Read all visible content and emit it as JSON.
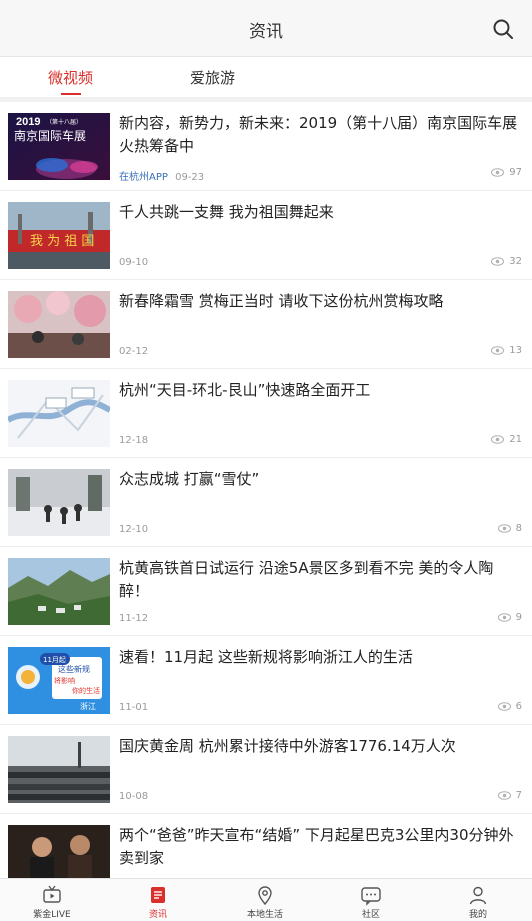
{
  "header": {
    "title": "资讯",
    "search_icon": "search-icon"
  },
  "tabs": [
    {
      "label": "微视频",
      "active": true
    },
    {
      "label": "爱旅游",
      "active": false
    }
  ],
  "news": [
    {
      "title": "新内容，新势力，新未来：2019（第十八届）南京国际车展火热筹备中",
      "source": "在杭州APP",
      "date": "09-23",
      "views": "97",
      "thumb_text": [
        "2019",
        "（第十八届）",
        "南京国际车展"
      ]
    },
    {
      "title": "千人共跳一支舞 我为祖国舞起来",
      "source": "",
      "date": "09-10",
      "views": "32"
    },
    {
      "title": "新春降霜雪 赏梅正当时 请收下这份杭州赏梅攻略",
      "source": "",
      "date": "02-12",
      "views": "13"
    },
    {
      "title": "杭州“天目-环北-艮山”快速路全面开工",
      "source": "",
      "date": "12-18",
      "views": "21"
    },
    {
      "title": "众志成城 打赢“雪仗”",
      "source": "",
      "date": "12-10",
      "views": "8"
    },
    {
      "title": "杭黄高铁首日试运行 沿途5A景区多到看不完 美的令人陶醉！",
      "source": "",
      "date": "11-12",
      "views": "9"
    },
    {
      "title": "速看！11月起 这些新规将影响浙江人的生活",
      "source": "",
      "date": "11-01",
      "views": "6",
      "thumb_text": [
        "11月起",
        "这些新规",
        "将影响",
        "你的生活",
        "浙江"
      ]
    },
    {
      "title": "国庆黄金周 杭州累计接待中外游客1776.14万人次",
      "source": "",
      "date": "10-08",
      "views": "7"
    },
    {
      "title": "两个“爸爸”昨天宣布“结婚” 下月起星巴克3公里内30分钟外卖到家",
      "source": "",
      "date": "",
      "views": ""
    }
  ],
  "bottom_nav": [
    {
      "label": "紫金LIVE",
      "icon": "tv-icon",
      "active": false
    },
    {
      "label": "资讯",
      "icon": "news-icon",
      "active": true
    },
    {
      "label": "本地生活",
      "icon": "location-icon",
      "active": false
    },
    {
      "label": "社区",
      "icon": "chat-icon",
      "active": false
    },
    {
      "label": "我的",
      "icon": "user-icon",
      "active": false
    }
  ],
  "colors": {
    "accent": "#d9302b",
    "source_link": "#3b6fb6",
    "meta": "#9a9a9a"
  }
}
